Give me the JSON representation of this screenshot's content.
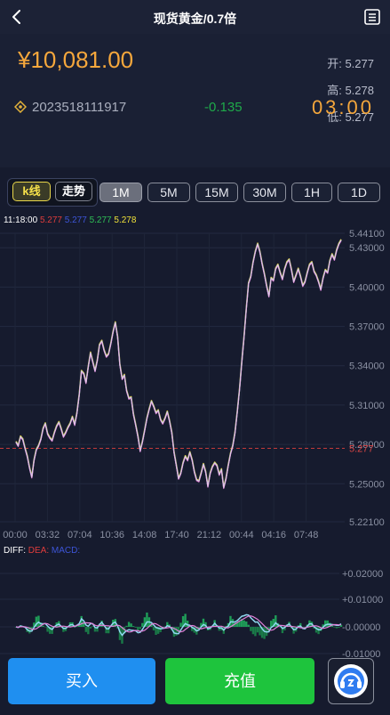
{
  "header": {
    "title": "现货黄金/0.7倍"
  },
  "quote": {
    "price": "¥10,081.00",
    "open_label": "开:",
    "open": "5.277",
    "high_label": "高:",
    "high": "5.278",
    "low_label": "低:",
    "low": "5.277",
    "code": "2023518111917",
    "change": "-0.135",
    "countdown": "03:00"
  },
  "modes": [
    {
      "label": "k线",
      "active": true
    },
    {
      "label": "走势",
      "active": false
    }
  ],
  "periods": [
    {
      "label": "1M",
      "active": true
    },
    {
      "label": "5M",
      "active": false
    },
    {
      "label": "15M",
      "active": false
    },
    {
      "label": "30M",
      "active": false
    },
    {
      "label": "1H",
      "active": false
    },
    {
      "label": "1D",
      "active": false
    }
  ],
  "legend": {
    "time": "11:18:00",
    "v1": "5.277",
    "v2": "5.277",
    "v3": "5.277",
    "v4": "5.278"
  },
  "colors": {
    "accent": "#f5a73c",
    "green": "#1ec43d",
    "blue": "#1f8ff0",
    "grid": "#262d44"
  },
  "chart_data": {
    "type": "line",
    "y_ticks": [
      "5.44100",
      "5.43000",
      "5.40000",
      "5.37000",
      "5.34000",
      "5.31000",
      "5.28000",
      "5.25000",
      "5.22100"
    ],
    "ylim": [
      5.221,
      5.441
    ],
    "x_ticks": [
      "00:00",
      "03:32",
      "07:04",
      "10:36",
      "14:08",
      "17:40",
      "21:12",
      "00:44",
      "04:16",
      "07:48"
    ],
    "current_value": "5.277",
    "series": [
      {
        "values": [
          5.282,
          5.279,
          5.286,
          5.284,
          5.277,
          5.271,
          5.262,
          5.255,
          5.268,
          5.276,
          5.279,
          5.284,
          5.292,
          5.296,
          5.288,
          5.285,
          5.283,
          5.289,
          5.294,
          5.297,
          5.292,
          5.286,
          5.289,
          5.293,
          5.296,
          5.301,
          5.295,
          5.304,
          5.318,
          5.336,
          5.334,
          5.327,
          5.339,
          5.35,
          5.343,
          5.336,
          5.344,
          5.356,
          5.359,
          5.352,
          5.347,
          5.349,
          5.357,
          5.366,
          5.373,
          5.362,
          5.341,
          5.33,
          5.333,
          5.321,
          5.315,
          5.316,
          5.303,
          5.295,
          5.286,
          5.275,
          5.282,
          5.291,
          5.3,
          5.307,
          5.313,
          5.309,
          5.304,
          5.306,
          5.299,
          5.296,
          5.3,
          5.305,
          5.298,
          5.289,
          5.274,
          5.264,
          5.254,
          5.258,
          5.266,
          5.271,
          5.268,
          5.274,
          5.268,
          5.259,
          5.253,
          5.252,
          5.258,
          5.265,
          5.259,
          5.248,
          5.258,
          5.263,
          5.266,
          5.264,
          5.257,
          5.261,
          5.247,
          5.254,
          5.264,
          5.273,
          5.279,
          5.289,
          5.305,
          5.322,
          5.343,
          5.362,
          5.384,
          5.403,
          5.408,
          5.419,
          5.427,
          5.433,
          5.427,
          5.418,
          5.41,
          5.401,
          5.393,
          5.407,
          5.405,
          5.414,
          5.417,
          5.411,
          5.406,
          5.414,
          5.419,
          5.421,
          5.413,
          5.404,
          5.409,
          5.414,
          5.408,
          5.401,
          5.404,
          5.411,
          5.417,
          5.419,
          5.412,
          5.409,
          5.404,
          5.398,
          5.407,
          5.413,
          5.411,
          5.42,
          5.425,
          5.421,
          5.428,
          5.433,
          5.436
        ]
      }
    ]
  },
  "diff": {
    "label": "DIFF:",
    "dea_label": "DEA:",
    "macd_label": "MACD:",
    "y_ticks": [
      "+0.02000",
      "+0.01000",
      "-0.00000",
      "-0.01000"
    ]
  },
  "actions": {
    "buy": "买入",
    "recharge": "充值"
  }
}
